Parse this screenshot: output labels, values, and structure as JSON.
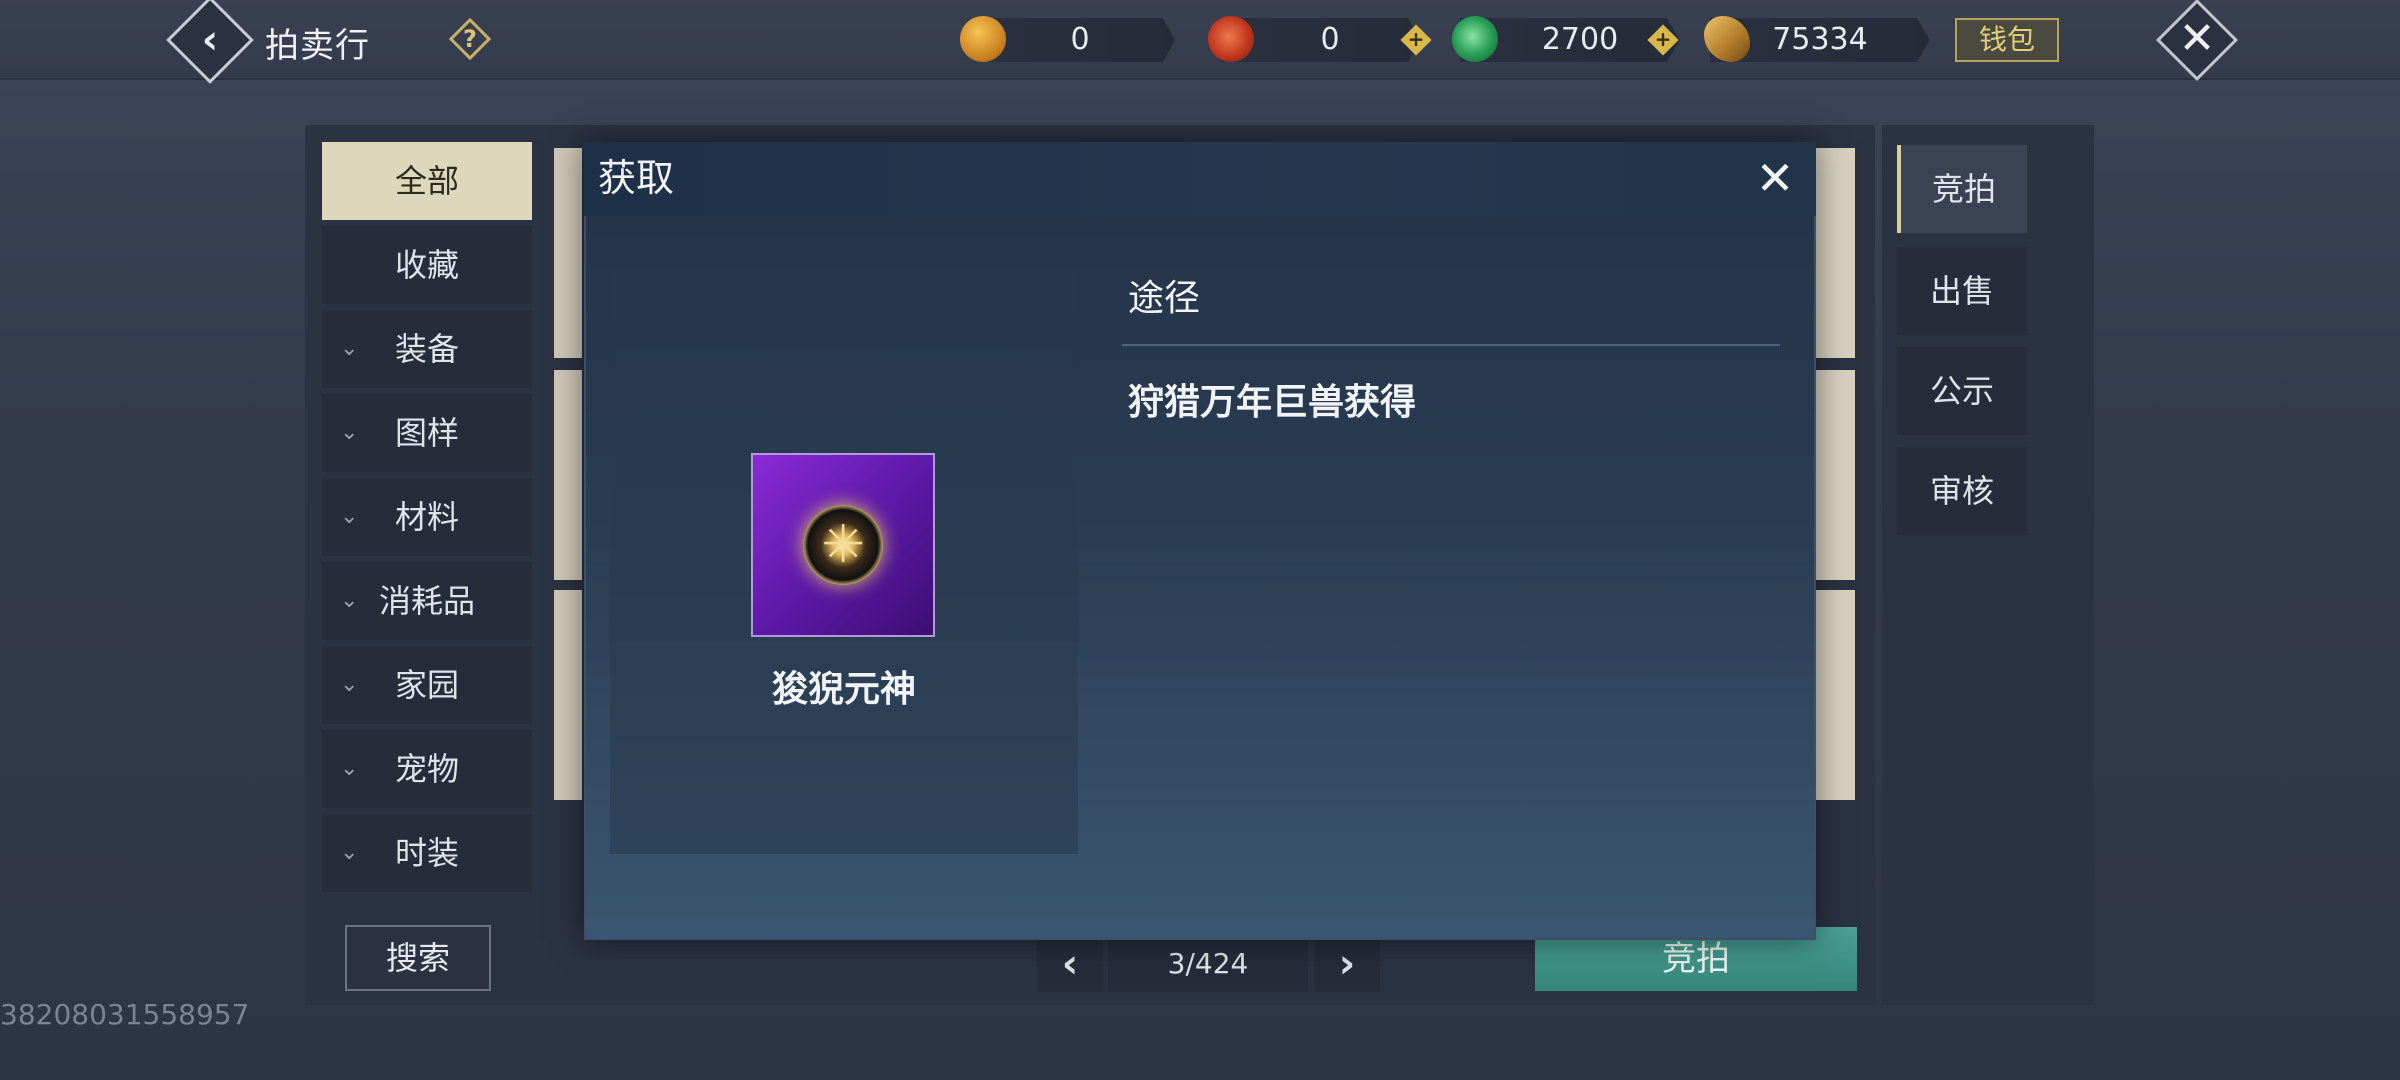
{
  "header": {
    "title": "拍卖行",
    "help": "?",
    "wallet_label": "钱包",
    "currencies": [
      {
        "icon": "gold-ingot-icon",
        "value": "0",
        "color": "#d08a1e"
      },
      {
        "icon": "red-swirl-icon",
        "value": "0",
        "color": "#c4402a"
      },
      {
        "icon": "jade-coin-icon",
        "value": "2700",
        "color": "#2fa35a"
      },
      {
        "icon": "bronze-token-icon",
        "value": "75334",
        "color": "#c9903a"
      }
    ]
  },
  "left_menu": {
    "items": [
      {
        "label": "全部",
        "active": true
      },
      {
        "label": "收藏"
      },
      {
        "label": "装备"
      },
      {
        "label": "图样"
      },
      {
        "label": "材料"
      },
      {
        "label": "消耗品"
      },
      {
        "label": "家园"
      },
      {
        "label": "宠物"
      },
      {
        "label": "时装"
      }
    ]
  },
  "right_tabs": {
    "items": [
      {
        "label": "竞拍",
        "active": true
      },
      {
        "label": "出售"
      },
      {
        "label": "公示"
      },
      {
        "label": "审核"
      }
    ]
  },
  "bottom": {
    "search_label": "搜索",
    "page_text": "3/424",
    "bid_label": "竞拍",
    "id_text": "38208031558957"
  },
  "modal": {
    "title": "获取",
    "item_name": "狻猊元神",
    "route_label": "途径",
    "route_text": "狩猎万年巨兽获得"
  }
}
